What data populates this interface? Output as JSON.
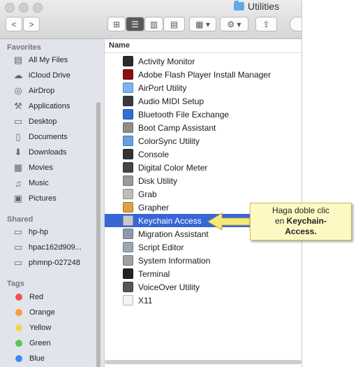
{
  "window": {
    "title": "Utilities"
  },
  "toolbar": {
    "back": "<",
    "forward": ">",
    "view_icons": "⊞",
    "view_list": "☰",
    "view_columns": "▥",
    "view_coverflow": "▤",
    "arrange": "▦ ▾",
    "action": "⚙ ▾",
    "share": "⇪"
  },
  "sidebar": {
    "favorites_header": "Favorites",
    "favorites": [
      {
        "label": "All My Files",
        "icon": "all-files-icon"
      },
      {
        "label": "iCloud Drive",
        "icon": "cloud-icon"
      },
      {
        "label": "AirDrop",
        "icon": "airdrop-icon"
      },
      {
        "label": "Applications",
        "icon": "applications-icon"
      },
      {
        "label": "Desktop",
        "icon": "desktop-icon"
      },
      {
        "label": "Documents",
        "icon": "documents-icon"
      },
      {
        "label": "Downloads",
        "icon": "downloads-icon"
      },
      {
        "label": "Movies",
        "icon": "movies-icon"
      },
      {
        "label": "Music",
        "icon": "music-icon"
      },
      {
        "label": "Pictures",
        "icon": "pictures-icon"
      }
    ],
    "shared_header": "Shared",
    "shared": [
      {
        "label": "hp-hp"
      },
      {
        "label": "hpac162d909..."
      },
      {
        "label": "phmnp-027248"
      }
    ],
    "tags_header": "Tags",
    "tags": [
      {
        "label": "Red",
        "color": "#f0524f"
      },
      {
        "label": "Orange",
        "color": "#f5a03c"
      },
      {
        "label": "Yellow",
        "color": "#f4d54a"
      },
      {
        "label": "Green",
        "color": "#5dc54f"
      },
      {
        "label": "Blue",
        "color": "#3a8ef0"
      }
    ]
  },
  "list": {
    "column_name": "Name",
    "items": [
      {
        "label": "Activity Monitor",
        "color": "#2b2b2b"
      },
      {
        "label": "Adobe Flash Player Install Manager",
        "color": "#8c1010"
      },
      {
        "label": "AirPort Utility",
        "color": "#7ab6f0"
      },
      {
        "label": "Audio MIDI Setup",
        "color": "#3a3a3a"
      },
      {
        "label": "Bluetooth File Exchange",
        "color": "#2f6fd6"
      },
      {
        "label": "Boot Camp Assistant",
        "color": "#8d8d8d"
      },
      {
        "label": "ColorSync Utility",
        "color": "#6aa0e0"
      },
      {
        "label": "Console",
        "color": "#333333"
      },
      {
        "label": "Digital Color Meter",
        "color": "#444444"
      },
      {
        "label": "Disk Utility",
        "color": "#9a9a9a"
      },
      {
        "label": "Grab",
        "color": "#bdbdbd"
      },
      {
        "label": "Grapher",
        "color": "#e0a040"
      },
      {
        "label": "Keychain Access",
        "color": "#c9c9c9",
        "selected": true
      },
      {
        "label": "Migration Assistant",
        "color": "#8a9ab0"
      },
      {
        "label": "Script Editor",
        "color": "#9aa7b8"
      },
      {
        "label": "System Information",
        "color": "#a0a0a0"
      },
      {
        "label": "Terminal",
        "color": "#222222"
      },
      {
        "label": "VoiceOver Utility",
        "color": "#555555"
      },
      {
        "label": "X11",
        "color": "#f4f4f4"
      }
    ]
  },
  "callout": {
    "line1": "Haga doble clic",
    "line2_prefix": "en ",
    "line2_bold": "Keychain-",
    "line3_bold": "Access."
  }
}
